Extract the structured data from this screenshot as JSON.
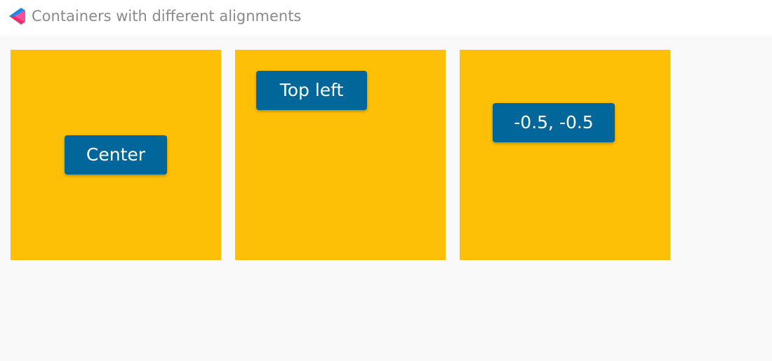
{
  "window": {
    "title": "Containers with different alignments"
  },
  "colors": {
    "container_background": "#fec007",
    "button_background": "#01669a",
    "button_text": "#ffffff",
    "page_background": "#f9f9f9",
    "title_text": "#8a8a8a"
  },
  "containers": [
    {
      "alignment": "center",
      "button_label": "Center"
    },
    {
      "alignment": "top left",
      "button_label": "Top left"
    },
    {
      "alignment": "-0.5, -0.5",
      "button_label": "-0.5, -0.5"
    }
  ]
}
